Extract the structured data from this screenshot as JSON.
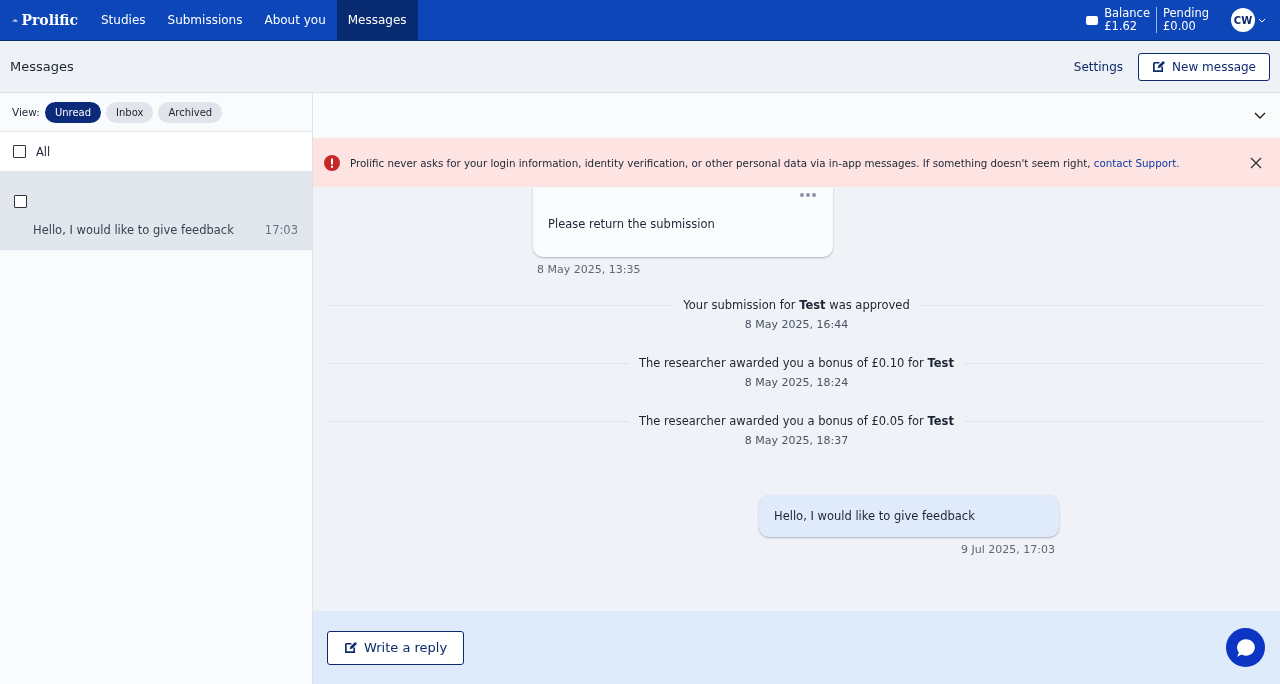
{
  "nav": {
    "logo": "Prolific",
    "items": [
      {
        "label": "Studies",
        "selected": false
      },
      {
        "label": "Submissions",
        "selected": false
      },
      {
        "label": "About you",
        "selected": false
      },
      {
        "label": "Messages",
        "selected": true
      }
    ],
    "balance": {
      "label": "Balance",
      "value": "£1.62"
    },
    "pending": {
      "label": "Pending",
      "value": "£0.00"
    },
    "avatar": "CW"
  },
  "header": {
    "title": "Messages",
    "settings": "Settings",
    "new_message": "New message"
  },
  "sidebar": {
    "view_label": "View:",
    "views": [
      {
        "label": "Unread",
        "selected": true
      },
      {
        "label": "Inbox",
        "selected": false
      },
      {
        "label": "Archived",
        "selected": false
      }
    ],
    "all": {
      "label": "All",
      "checked": false
    },
    "threads": [
      {
        "preview": "Hello, I would like to give feedback",
        "time": "17:03",
        "selected": true,
        "checked": false
      }
    ]
  },
  "banner": {
    "text": "Prolific never asks for your login information, identity verification, or other personal data via in-app messages. If something doesn't seem right,",
    "link": "contact Support."
  },
  "conversation": [
    {
      "kind": "received",
      "text": "Please return the submission",
      "time": "8 May 2025, 13:35"
    },
    {
      "kind": "event",
      "text": "Your submission for **Test** was approved",
      "time": "8 May 2025, 16:44"
    },
    {
      "kind": "event",
      "text": "The researcher awarded you a bonus of £0.10 for **Test**",
      "time": "8 May 2025, 18:24"
    },
    {
      "kind": "event",
      "text": "The researcher awarded you a bonus of £0.05 for **Test**",
      "time": "8 May 2025, 18:37"
    },
    {
      "kind": "sent",
      "text": "Hello, I would like to give feedback",
      "time": "9 Jul 2025, 17:03"
    }
  ],
  "reply_button": "Write a reply"
}
